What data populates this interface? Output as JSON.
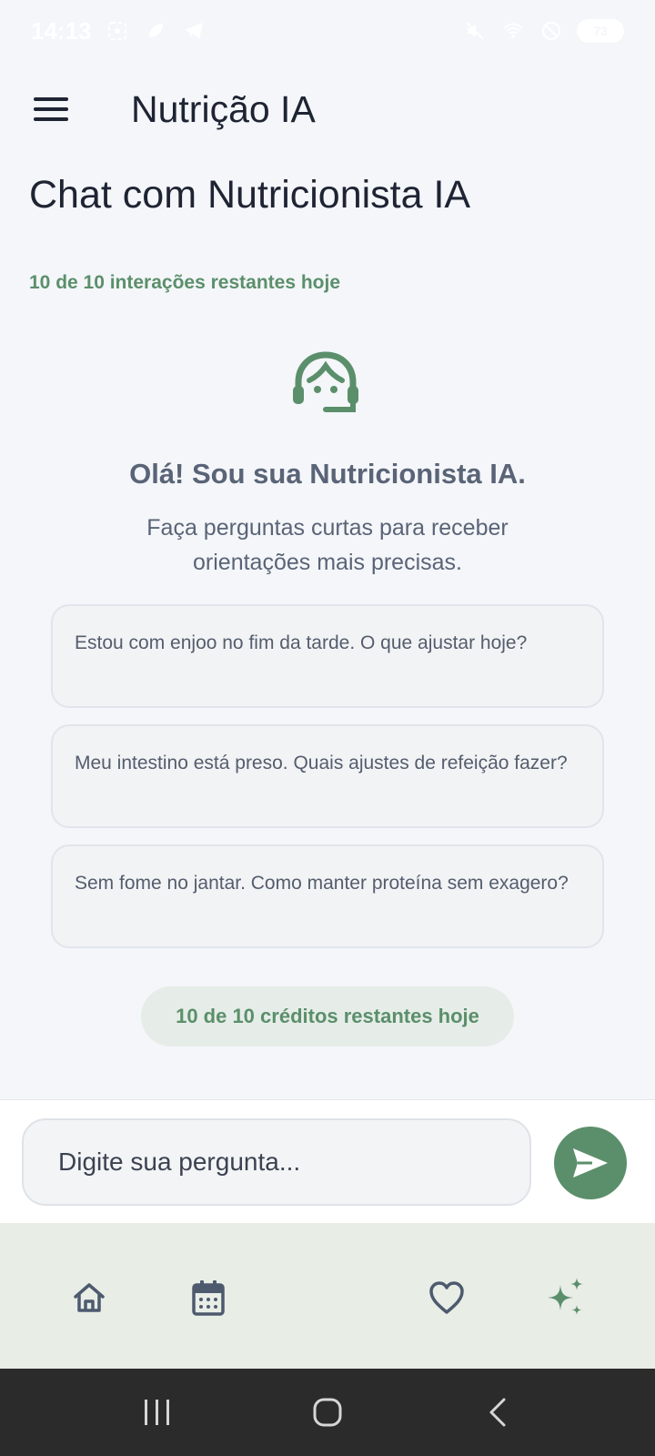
{
  "status_bar": {
    "time": "14:13",
    "battery": "73"
  },
  "app_bar": {
    "title": "Nutrição IA"
  },
  "page": {
    "title": "Chat com Nutricionista IA",
    "interactions_remaining": "10 de 10 interações restantes hoje"
  },
  "welcome": {
    "heading": "Olá! Sou sua Nutricionista IA.",
    "subtitle": "Faça perguntas curtas para receber orientações mais precisas."
  },
  "suggestions": [
    "Estou com enjoo no fim da tarde. O que ajustar hoje?",
    "Meu intestino está preso. Quais ajustes de refeição fazer?",
    "Sem fome no jantar. Como manter proteína sem exagero?"
  ],
  "credits": {
    "label": "10 de 10 créditos restantes hoje"
  },
  "input": {
    "placeholder": "Digite sua pergunta..."
  },
  "bottom_nav": {
    "items": [
      "home-icon",
      "calendar-icon",
      "heart-icon",
      "sparkles-icon"
    ]
  },
  "colors": {
    "accent": "#5b8f6b",
    "background": "#f4f6f9",
    "nav_background": "#e8ede6"
  }
}
